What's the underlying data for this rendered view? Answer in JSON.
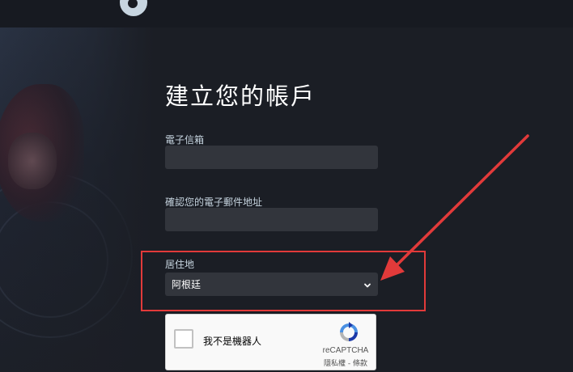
{
  "header": {
    "logo_icon": "steam-logo-icon"
  },
  "form": {
    "title": "建立您的帳戶",
    "email": {
      "label": "電子信箱",
      "value": "",
      "placeholder": ""
    },
    "confirm_email": {
      "label": "確認您的電子郵件地址",
      "value": "",
      "placeholder": ""
    },
    "country": {
      "label": "居住地",
      "selected": "阿根廷",
      "icon": "chevron-down-icon"
    }
  },
  "captcha": {
    "label": "我不是機器人",
    "brand": "reCAPTCHA",
    "links": "隱私權 - 條款",
    "logo_icon": "recaptcha-logo-icon"
  },
  "annotation": {
    "color": "#e23a3a"
  },
  "colors": {
    "background": "#1b1e25",
    "topbar": "#171a21",
    "input_bg": "#32353c",
    "label_text": "#c6d4df"
  }
}
